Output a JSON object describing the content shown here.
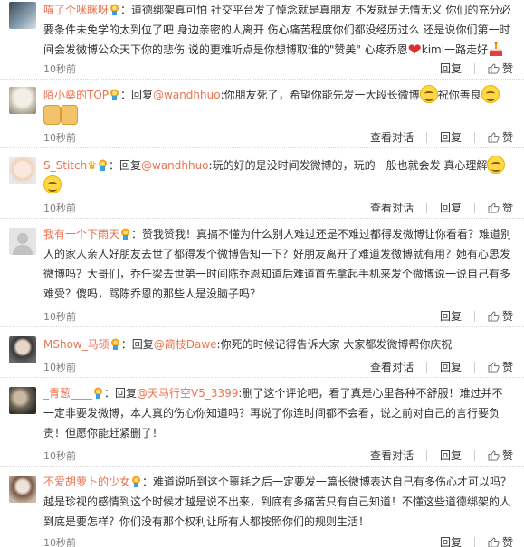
{
  "actions": {
    "view_dialog": "查看对话",
    "reply": "回复",
    "like": "赞"
  },
  "colors": {
    "name": "#eb7350",
    "text": "#333333",
    "time": "#808080"
  },
  "comments": [
    {
      "name": "喵了个咪眯呀",
      "body1": "：道德绑架真可怕 社交平台发了悼念就是真朋友 不发就是无情无义 你们的充分必",
      "body2": "要条件未免学的太到位了吧 身边亲密的人离开 伤心痛苦程度你们都没经历过么 还是说你们第一时",
      "body3a": "间会发微博公众天下你的悲伤 说的更难听点是你想博取谁的\"赞美\" 心疼乔恩",
      "body3b": "kimi一路走好",
      "time": "10秒前"
    },
    {
      "name": "陌小燊的TOP",
      "reply_label": "：回复",
      "mention": "@wandhhuo",
      "body1": ":你朋友死了，希望你能先发一大段长微博",
      "body1b": "祝你善良",
      "time": "10秒前"
    },
    {
      "name": "S_Stitch",
      "reply_label": "：回复",
      "mention": "@wandhhuo",
      "body1": ":玩的好的是没时间发微博的，玩的一般也就会发 真心理解",
      "time": "10秒前"
    },
    {
      "name": "我有一个下雨天",
      "body1": "：赞我赞我！真搞不懂为什么别人难过还是不难过都得发微博让你看看？难道别",
      "body2": "人的家人亲人好朋友去世了都得发个微博告知一下？好朋友离开了难道发微博就有用？她有心思发",
      "body3": "微博吗？大哥们，乔任梁去世第一时间陈乔恩知道后难道首先拿起手机来发个微博说一说自己有多",
      "body4": "难受？傻吗，骂陈乔恩的那些人是没脑子吗？",
      "time": "10秒前"
    },
    {
      "name": "MShow_马硕",
      "reply_label": "：回复",
      "mention": "@简枝Dawe",
      "body1": ":你死的时候记得告诉大家 大家都发微博帮你庆祝",
      "time": "10秒前"
    },
    {
      "name": "_青葱____",
      "reply_label": "：回复",
      "mention": "@天马行空V5_3399",
      "body1": ":删了这个评论吧，看了真是心里各种不舒服！难过并不",
      "body2": "一定非要发微博，本人真的伤心你知道吗？再说了你连时间都不会看，说之前对自己的言行要负",
      "body3": "责！但愿你能赶紧删了！",
      "time": "10秒前"
    },
    {
      "name": "不爱胡萝卜的少女",
      "body1": "：难道说听到这个噩耗之后一定要发一篇长微博表达自己有多伤心才可以吗？",
      "body2": "越是珍视的感情到这个时候才越是说不出来，到底有多痛苦只有自己知道！不懂这些道德绑架的人",
      "body3": "到底是要怎样？你们没有那个权利让所有人都按照你们的规则生活！",
      "time": "10秒前"
    }
  ]
}
